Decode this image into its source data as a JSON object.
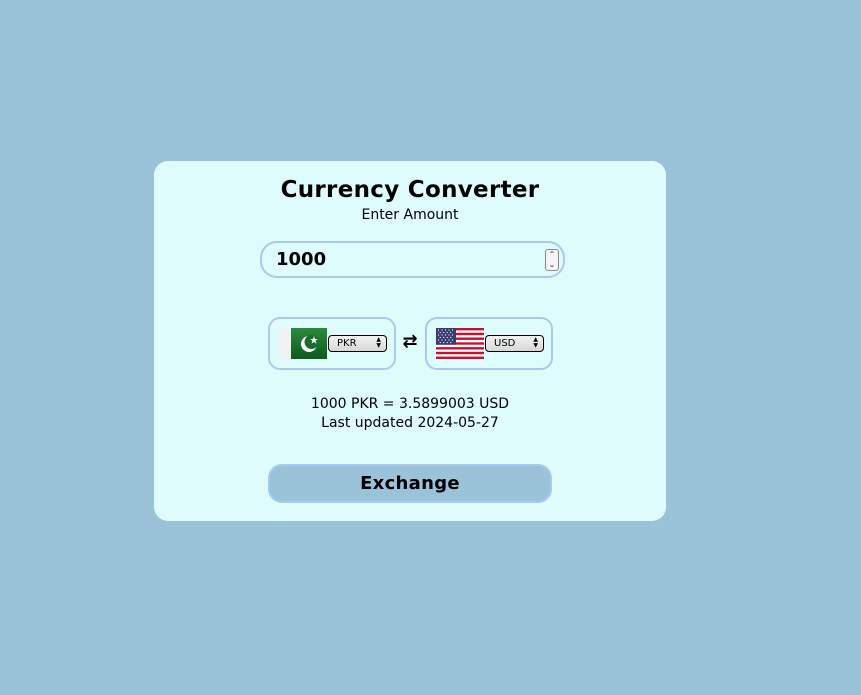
{
  "app": {
    "title": "Currency Converter",
    "subtitle": "Enter Amount"
  },
  "amount": {
    "value": "1000"
  },
  "from": {
    "currency": "PKR",
    "flag": "pakistan-flag"
  },
  "to": {
    "currency": "USD",
    "flag": "usa-flag"
  },
  "swap_icon": "swap-arrows-icon",
  "result": {
    "conversion": "1000 PKR = 3.5899003 USD",
    "updated": "Last updated 2024-05-27"
  },
  "button": {
    "label": "Exchange"
  },
  "colors": {
    "page_bg": "#9ac2d9",
    "card_bg": "#ddfcfb",
    "border": "#aac9f1",
    "button_bg": "#9ac2d9"
  }
}
